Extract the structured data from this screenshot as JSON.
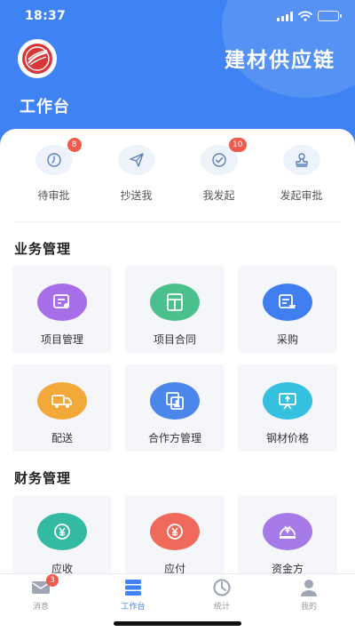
{
  "status_bar": {
    "time": "18:37"
  },
  "header": {
    "app_title": "建材供应链",
    "page_title": "工作台"
  },
  "quick_actions": [
    {
      "label": "待审批",
      "icon": "clock-icon",
      "badge": "8"
    },
    {
      "label": "抄送我",
      "icon": "send-icon",
      "badge": ""
    },
    {
      "label": "我发起",
      "icon": "check-circle-icon",
      "badge": "10"
    },
    {
      "label": "发起审批",
      "icon": "stamp-icon",
      "badge": ""
    }
  ],
  "business": {
    "title": "业务管理",
    "items": [
      {
        "label": "项目管理",
        "icon": "project-doc-icon",
        "color": "#a86ee8"
      },
      {
        "label": "项目合同",
        "icon": "contract-icon",
        "color": "#4cc08c"
      },
      {
        "label": "采购",
        "icon": "purchase-cart-icon",
        "color": "#3f7ff0"
      },
      {
        "label": "配送",
        "icon": "truck-icon",
        "color": "#f2a93a"
      },
      {
        "label": "合作方管理",
        "icon": "partner-icon",
        "color": "#4b86ea"
      },
      {
        "label": "钢材价格",
        "icon": "price-board-icon",
        "color": "#35c0e0"
      }
    ]
  },
  "finance": {
    "title": "财务管理",
    "items": [
      {
        "label": "应收",
        "icon": "yen-receive-icon",
        "color": "#34b9a3"
      },
      {
        "label": "应付",
        "icon": "yen-pay-icon",
        "color": "#ef6a5a"
      },
      {
        "label": "资金方",
        "icon": "yen-funder-icon",
        "color": "#a57ae8"
      }
    ]
  },
  "tabbar": {
    "tabs": [
      {
        "label": "消息",
        "icon": "message-icon",
        "badge": "3",
        "active": false
      },
      {
        "label": "工作台",
        "icon": "workbench-icon",
        "badge": "",
        "active": true
      },
      {
        "label": "统计",
        "icon": "statistics-icon",
        "badge": "",
        "active": false
      },
      {
        "label": "我的",
        "icon": "user-icon",
        "badge": "",
        "active": false
      }
    ]
  },
  "colors": {
    "primary": "#3f82f3",
    "badge": "#ef5a4c",
    "card_bg": "#f4f6fa"
  }
}
